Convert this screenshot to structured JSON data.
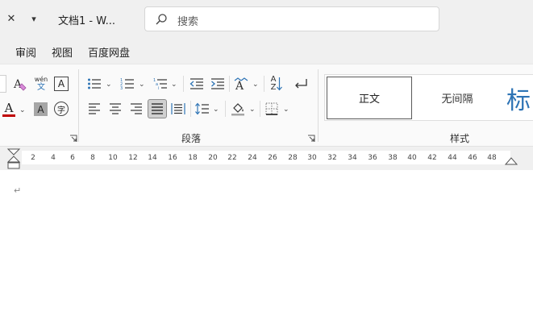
{
  "titlebar": {
    "close_glyph": "✕",
    "qat_glyph": "▾",
    "doc_title": "文档1  -  W...",
    "search_placeholder": "搜索",
    "icons": [
      "close-icon",
      "customize-qat-icon",
      "search-icon"
    ]
  },
  "menu": {
    "items": [
      "审阅",
      "视图",
      "百度网盘"
    ]
  },
  "ribbon": {
    "font_group": {
      "phonetic_top": "wén",
      "phonetic_bottom": "文",
      "border_char": "A",
      "font_color_char": "A",
      "shading_char": "A",
      "enclose_char": "字",
      "font_color": "#c00000"
    },
    "paragraph_group": {
      "label": "段落",
      "sort_top": "A",
      "sort_bottom": "Z"
    },
    "styles_group": {
      "label": "样式",
      "items": [
        "正文",
        "无间隔",
        "标"
      ]
    }
  },
  "ruler": {
    "ticks": [
      "2",
      "4",
      "6",
      "8",
      "10",
      "12",
      "14",
      "16",
      "18",
      "20",
      "22",
      "24",
      "26",
      "28",
      "30",
      "32",
      "34",
      "36",
      "38",
      "40",
      "42",
      "44",
      "46",
      "48"
    ]
  },
  "document": {
    "paragraph_mark": "↵"
  },
  "colors": {
    "chrome_bg": "#f0f0f0",
    "ribbon_bg": "#fafafa",
    "title_style_color": "#2e74b5",
    "font_color_bar": "#c00000"
  }
}
